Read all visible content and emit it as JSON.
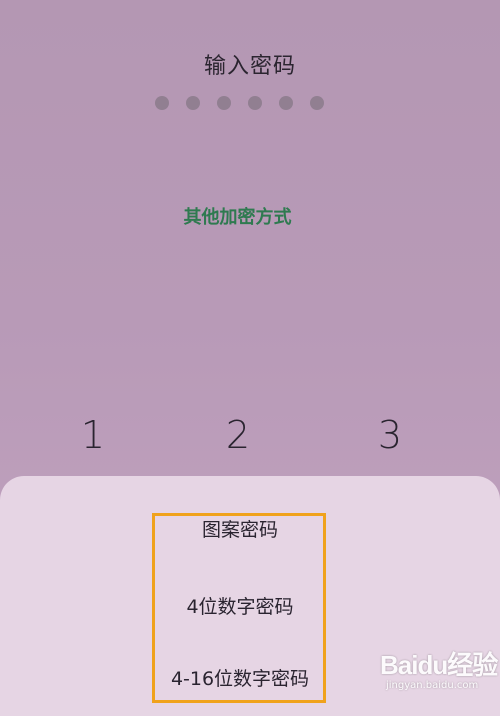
{
  "lock_screen": {
    "title": "输入密码",
    "entered_digits": 6,
    "other_methods_label": "其他加密方式"
  },
  "keypad": {
    "keys": [
      "1",
      "2",
      "3"
    ]
  },
  "sheet": {
    "options": [
      "图案密码",
      "4位数字密码",
      "4-16位数字密码"
    ],
    "highlight_color": "#f0a21c"
  },
  "watermark": {
    "logo_text": "Baidu经验",
    "url_text": "jingyan.baidu.com"
  },
  "colors": {
    "background": "#b89ab7",
    "accent_green": "#2f7a50",
    "sheet_bg": "#e6d5e4"
  }
}
